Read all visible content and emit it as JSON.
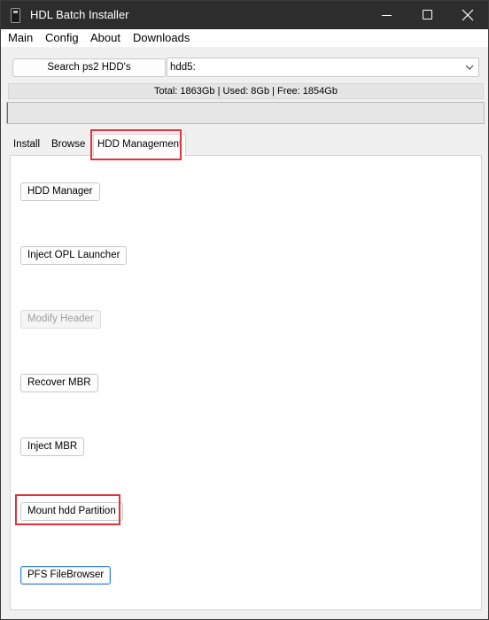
{
  "window": {
    "title": "HDL Batch Installer"
  },
  "menu": [
    "Main",
    "Config",
    "About",
    "Downloads"
  ],
  "toolbar": {
    "search_label": "Search ps2 HDD's",
    "drive_value": "hdd5:"
  },
  "status": {
    "text": "Total: 1863Gb | Used: 8Gb | Free: 1854Gb",
    "progress_fraction": 0.002
  },
  "tabs": [
    {
      "label": "Install"
    },
    {
      "label": "Browse"
    },
    {
      "label": "HDD Management",
      "active": true
    }
  ],
  "hdd_management": {
    "buttons": [
      {
        "label": "HDD Manager",
        "enabled": true
      },
      {
        "label": "Inject OPL Launcher",
        "enabled": true
      },
      {
        "label": "Modify Header",
        "enabled": false
      },
      {
        "label": "Recover MBR",
        "enabled": true
      },
      {
        "label": "Inject MBR",
        "enabled": true
      },
      {
        "label": "Mount hdd Partition",
        "enabled": true,
        "highlighted": true
      },
      {
        "label": "PFS FileBrowser",
        "enabled": true,
        "focused": true
      }
    ]
  },
  "colors": {
    "titlebar": "#2d2d2d",
    "highlight": "#e0333c",
    "progress": "#06b025",
    "focus": "#2f7fd4"
  }
}
